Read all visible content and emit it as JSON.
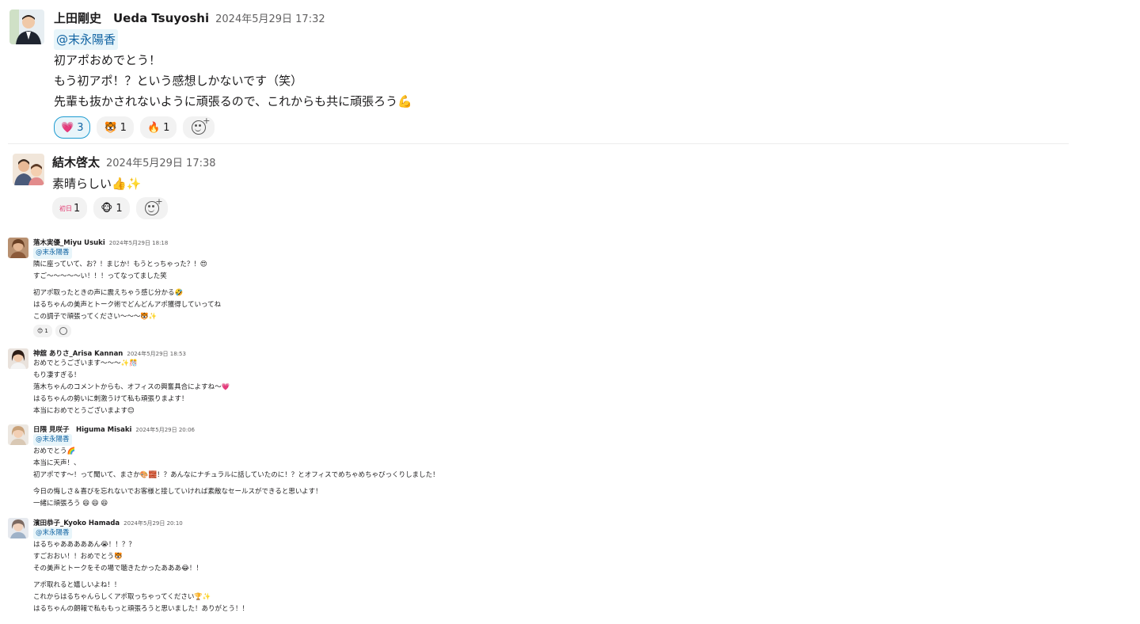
{
  "top_messages": [
    {
      "name": "上田剛史　Ueda Tsuyoshi",
      "time": "2024年5月29日 17:32",
      "mention": "@末永陽香",
      "lines": [
        "初アポおめでとう！",
        "もう初アポ！？という感想しかないです（笑）",
        "先輩も抜かされないように頑張るので、これからも共に頑張ろう💪"
      ],
      "reactions": [
        {
          "emoji": "💗",
          "count": "3",
          "active": true
        },
        {
          "emoji": "🐯",
          "count": "1",
          "active": false
        },
        {
          "emoji": "🔥",
          "count": "1",
          "active": false
        }
      ]
    },
    {
      "name": "結木啓太",
      "time": "2024年5月29日 17:38",
      "lines": [
        "素晴らしい👍✨"
      ],
      "reactions": [
        {
          "emoji": "初日",
          "count": "1",
          "active": false
        },
        {
          "emoji": "🐵",
          "count": "1",
          "active": false
        }
      ]
    }
  ],
  "small_messages": [
    {
      "name": "落木実優_Miyu Usuki",
      "time": "2024年5月29日 18:18",
      "mention": "@末永陽香",
      "blocks": [
        [
          "隣に座っていて、お？！まじか！もうとっちゃった？！😍",
          "すご〜〜〜〜〜い！！！ってなってました笑"
        ],
        [
          "初アポ取ったときの声に震えちゃう感じ分かる🤣",
          "はるちゃんの美声とトーク術でどんどんアポ獲得していってね",
          "この調子で頑張ってください〜〜〜🐯✨"
        ]
      ],
      "reactions": [
        {
          "emoji": "😊",
          "count": "1"
        }
      ]
    },
    {
      "name": "神舘 ありさ_Arisa Kannan",
      "time": "2024年5月29日 18:53",
      "blocks": [
        [
          "おめでとうございます〜〜〜✨🎊",
          "もり凄すぎる！",
          "落木ちゃんのコメントからも、オフィスの興奮具合によすね〜💗",
          "はるちゃんの勢いに刺激うけて私も頑張りまよす！",
          "本当におめでとうございまよす😊"
        ]
      ]
    },
    {
      "name": "日隈 見咲子　Higuma Misaki",
      "time": "2024年5月29日 20:06",
      "mention": "@末永陽香",
      "blocks": [
        [
          "おめでとう🌈",
          "本当に天声！、",
          "初アポです〜！って聞いて、まさか🎨🧱！？あんなにナチュラルに話していたのに！？とオフィスでめちゃめちゃびっくりしました！"
        ],
        [
          "今日の悔しさ＆喜びを忘れないでお客様と接していければ素敵なセールスができると思いよす！",
          "一緒に頑張ろう 😆 😆 😆"
        ]
      ]
    },
    {
      "name": "濱田恭子_Kyoko Hamada",
      "time": "2024年5月29日 20:10",
      "mention": "@末永陽香",
      "blocks": [
        [
          "はるちゃあああああん😭！！？？",
          "すごおおい！！おめでとう🐯",
          "その美声とトークをその場で聴きたかったあああ😂！！"
        ],
        [
          "アポ取れると嬉しいよね！！",
          "これからはるちゃんらしくアポ取っちゃってください🏆✨",
          "はるちゃんの朗報で私ももっと頑張ろうと思いました！ありがとう！！"
        ]
      ]
    }
  ]
}
